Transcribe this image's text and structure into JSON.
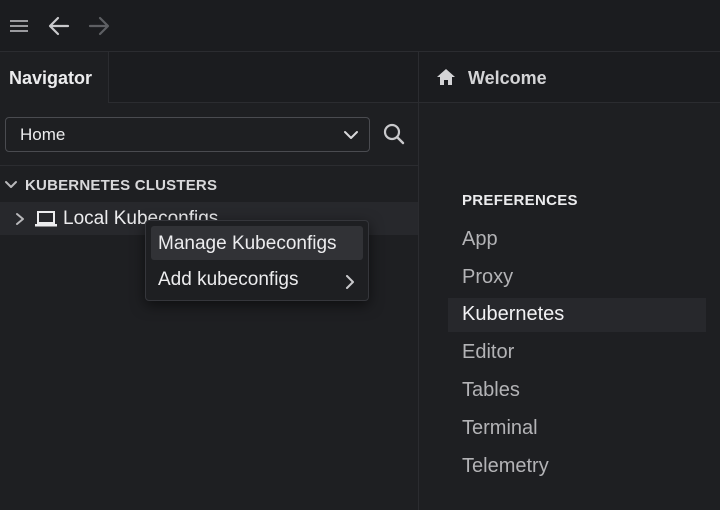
{
  "toolbar": {
    "menu_icon": "hamburger-icon",
    "back_icon": "arrow-left-icon",
    "forward_icon": "arrow-right-icon"
  },
  "navigator": {
    "tab_label": "Navigator",
    "select_value": "Home",
    "search_icon": "search-icon",
    "section_label": "KUBERNETES CLUSTERS",
    "tree_item_label": "Local Kubeconfigs"
  },
  "context_menu": {
    "items": [
      {
        "label": "Manage Kubeconfigs",
        "has_submenu": false
      },
      {
        "label": "Add kubeconfigs",
        "has_submenu": true
      }
    ]
  },
  "welcome": {
    "tab_label": "Welcome",
    "tab_icon": "home-icon"
  },
  "preferences": {
    "heading": "PREFERENCES",
    "items": [
      "App",
      "Proxy",
      "Kubernetes",
      "Editor",
      "Tables",
      "Terminal",
      "Telemetry"
    ],
    "active": "Kubernetes"
  },
  "colors": {
    "background": "#1e1f22",
    "toolbar": "#1b1c1f",
    "selected_row": "#27282c",
    "text": "#ececee",
    "muted_text": "#b3b3b6"
  }
}
